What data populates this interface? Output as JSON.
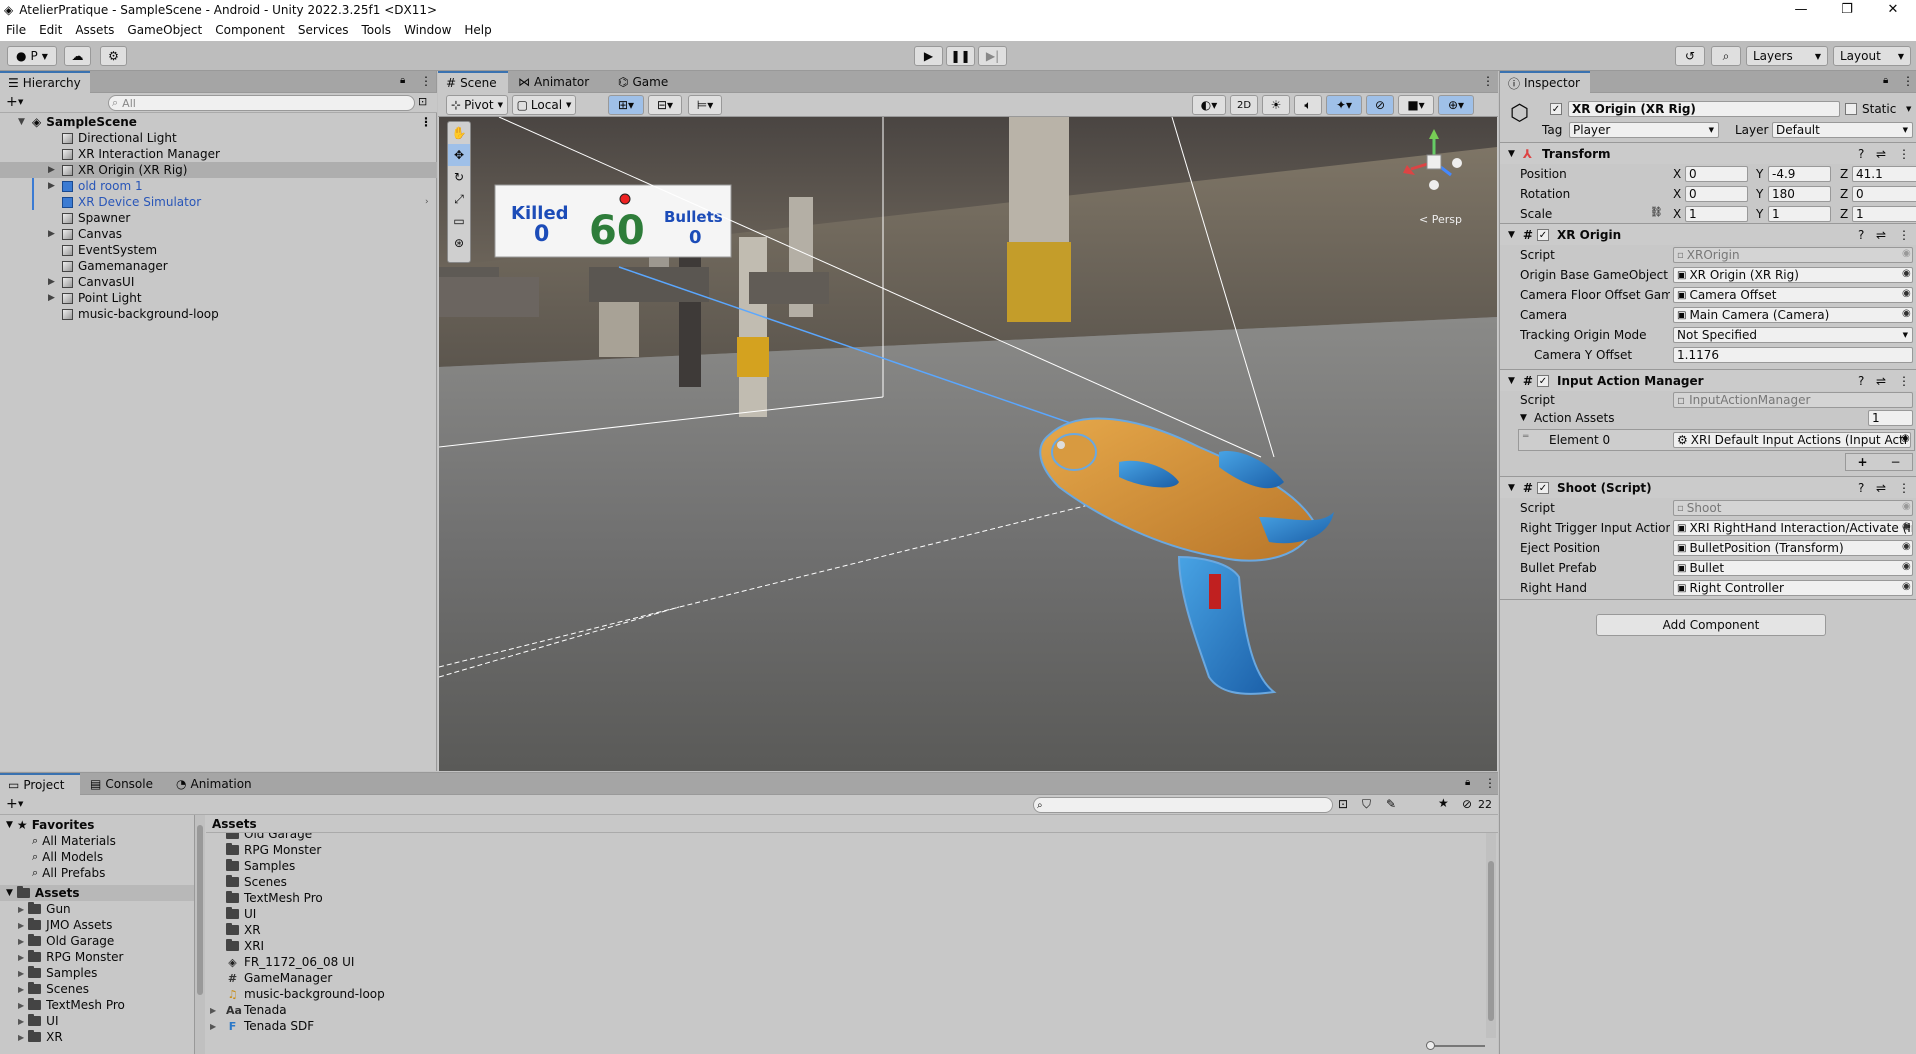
{
  "window": {
    "title": "AtelierPratique - SampleScene - Android - Unity 2022.3.25f1 <DX11>",
    "min": "—",
    "max": "❐",
    "close": "✕"
  },
  "menu": [
    "File",
    "Edit",
    "Assets",
    "GameObject",
    "Component",
    "Services",
    "Tools",
    "Window",
    "Help"
  ],
  "toolbar": {
    "account": "P",
    "layers": "Layers",
    "layout": "Layout"
  },
  "hierarchy": {
    "tab": "Hierarchy",
    "search_placeholder": "All",
    "scene": "SampleScene",
    "items": [
      {
        "label": "Directional Light",
        "expandable": false,
        "prefab": false
      },
      {
        "label": "XR Interaction Manager",
        "expandable": false,
        "prefab": false
      },
      {
        "label": "XR Origin (XR Rig)",
        "expandable": true,
        "prefab": false
      },
      {
        "label": "old room 1",
        "expandable": true,
        "prefab": true
      },
      {
        "label": "XR Device Simulator",
        "expandable": false,
        "prefab": true
      },
      {
        "label": "Spawner",
        "expandable": false,
        "prefab": false
      },
      {
        "label": "Canvas",
        "expandable": true,
        "prefab": false
      },
      {
        "label": "EventSystem",
        "expandable": false,
        "prefab": false
      },
      {
        "label": "Gamemanager",
        "expandable": false,
        "prefab": false
      },
      {
        "label": "CanvasUI",
        "expandable": true,
        "prefab": false
      },
      {
        "label": "Point Light",
        "expandable": true,
        "prefab": false
      },
      {
        "label": "music-background-loop",
        "expandable": false,
        "prefab": false
      }
    ]
  },
  "scene_view": {
    "tabs": [
      "Scene",
      "Animator",
      "Game"
    ],
    "pivot": "Pivot",
    "local": "Local",
    "mode_2d": "2D",
    "persp": "< Persp",
    "hud": {
      "killed_label": "Killed",
      "killed_value": "0",
      "timer": "60",
      "bullets_label": "Bullets",
      "bullets_value": "0"
    }
  },
  "inspector": {
    "tab": "Inspector",
    "object_name": "XR Origin (XR Rig)",
    "static_label": "Static",
    "tag_label": "Tag",
    "tag_value": "Player",
    "layer_label": "Layer",
    "layer_value": "Default",
    "transform": {
      "title": "Transform",
      "position_label": "Position",
      "position": [
        "0",
        "-4.9",
        "41.1"
      ],
      "rotation_label": "Rotation",
      "rotation": [
        "0",
        "180",
        "0"
      ],
      "scale_label": "Scale",
      "scale": [
        "1",
        "1",
        "1"
      ],
      "axes": [
        "X",
        "Y",
        "Z"
      ]
    },
    "xr_origin": {
      "title": "XR Origin",
      "fields": [
        {
          "label": "Script",
          "value": "XROrigin",
          "ro": true
        },
        {
          "label": "Origin Base GameObject",
          "value": "XR Origin (XR Rig)",
          "ro": false
        },
        {
          "label": "Camera Floor Offset Game",
          "value": "Camera Offset",
          "ro": false
        },
        {
          "label": "Camera",
          "value": "Main Camera (Camera)",
          "ro": false
        },
        {
          "label": "Tracking Origin Mode",
          "value": "Not Specified",
          "ro": false
        },
        {
          "label": "Camera Y Offset",
          "value": "1.1176",
          "ro": false
        }
      ]
    },
    "input_action_manager": {
      "title": "Input Action Manager",
      "script_label": "Script",
      "script_value": "InputActionManager",
      "action_assets_label": "Action Assets",
      "action_assets_count": "1",
      "element_label": "Element 0",
      "element_value": "XRI Default Input Actions (Input Acti",
      "plus": "+",
      "minus": "−"
    },
    "shoot": {
      "title": "Shoot (Script)",
      "fields": [
        {
          "label": "Script",
          "value": "Shoot",
          "ro": true
        },
        {
          "label": "Right Trigger Input Action",
          "value": "XRI RightHand Interaction/Activate (In",
          "ro": false
        },
        {
          "label": "Eject Position",
          "value": "BulletPosition (Transform)",
          "ro": false
        },
        {
          "label": "Bullet Prefab",
          "value": "Bullet",
          "ro": false
        },
        {
          "label": "Right Hand",
          "value": "Right Controller",
          "ro": false
        }
      ]
    },
    "add_component": "Add Component"
  },
  "project": {
    "tabs": [
      "Project",
      "Console",
      "Animation"
    ],
    "hidden_count": "22",
    "favorites_label": "Favorites",
    "favorites": [
      "All Materials",
      "All Models",
      "All Prefabs"
    ],
    "assets_label": "Assets",
    "tree": [
      "Gun",
      "JMO Assets",
      "Old Garage",
      "RPG Monster",
      "Samples",
      "Scenes",
      "TextMesh Pro",
      "UI",
      "XR"
    ],
    "breadcrumb": "Assets",
    "files": [
      {
        "label": "Old Garage",
        "type": "folder"
      },
      {
        "label": "RPG Monster",
        "type": "folder"
      },
      {
        "label": "Samples",
        "type": "folder"
      },
      {
        "label": "Scenes",
        "type": "folder"
      },
      {
        "label": "TextMesh Pro",
        "type": "folder"
      },
      {
        "label": "UI",
        "type": "folder"
      },
      {
        "label": "XR",
        "type": "folder"
      },
      {
        "label": "XRI",
        "type": "folder"
      },
      {
        "label": "FR_1172_06_08 UI",
        "type": "unity"
      },
      {
        "label": "GameManager",
        "type": "script"
      },
      {
        "label": "music-background-loop",
        "type": "audio"
      },
      {
        "label": "Tenada",
        "type": "font"
      },
      {
        "label": "Tenada SDF",
        "type": "fontasset"
      }
    ]
  }
}
